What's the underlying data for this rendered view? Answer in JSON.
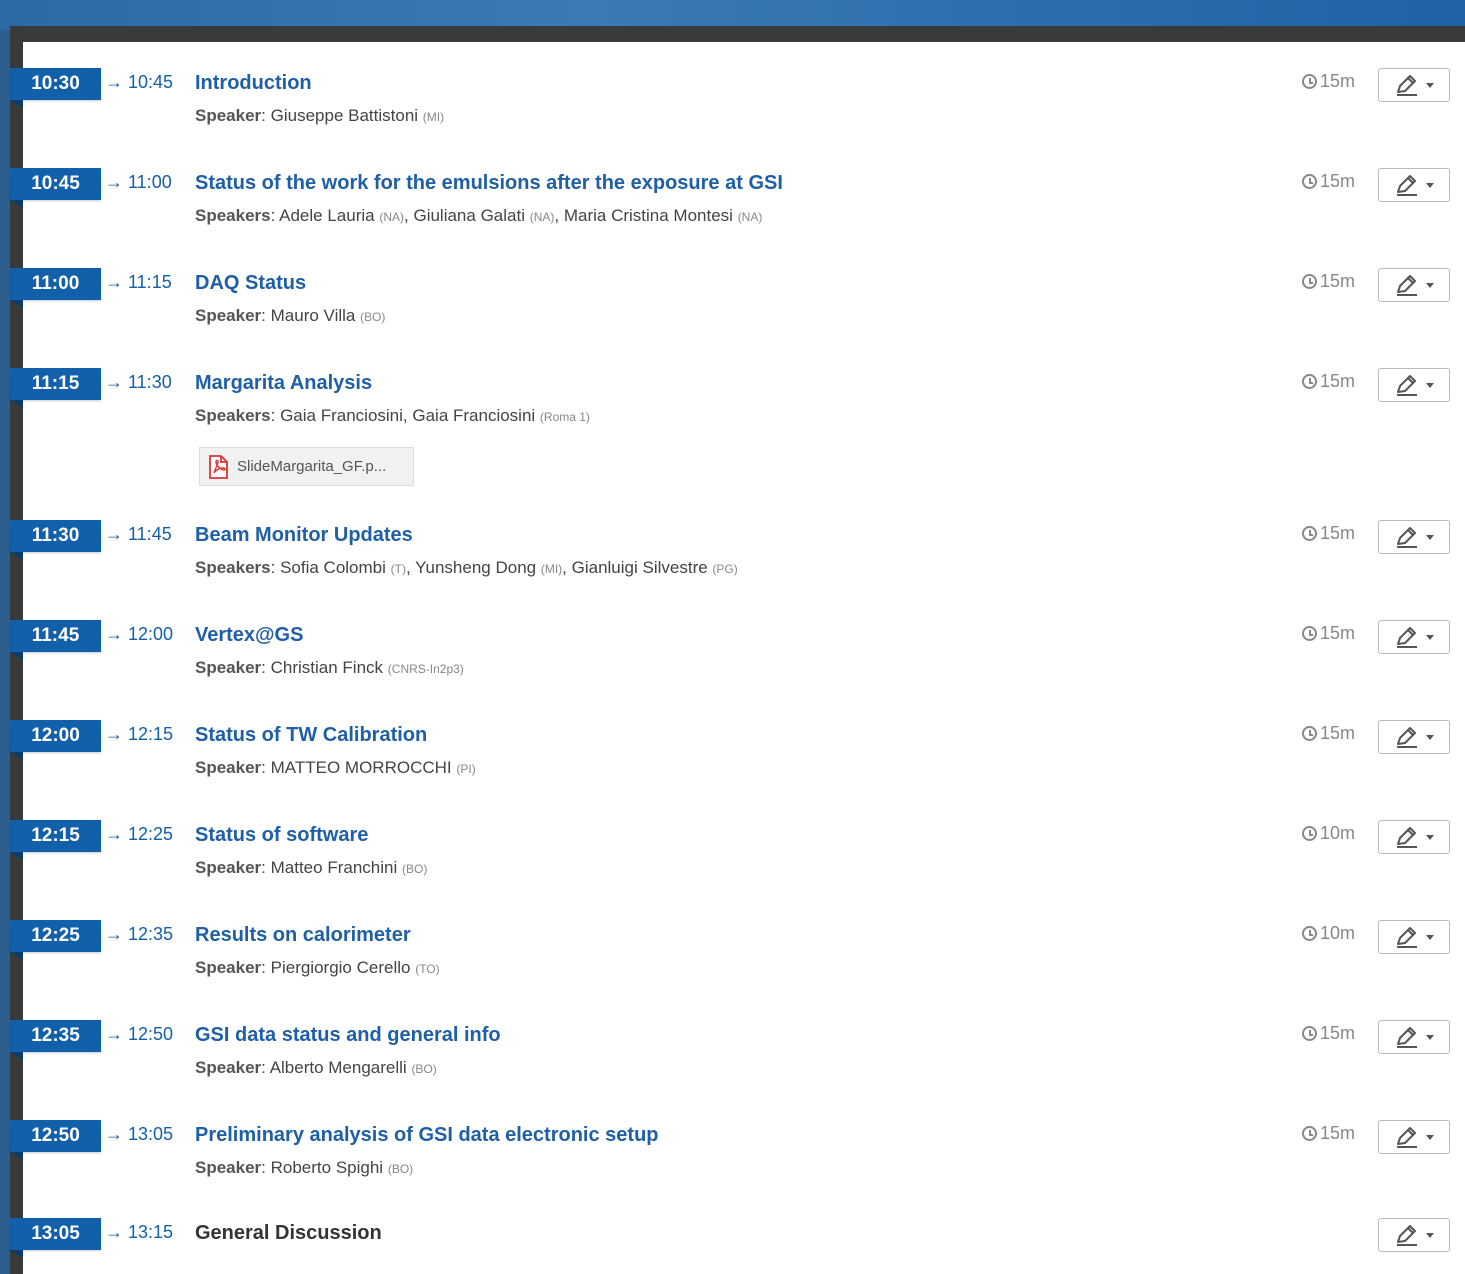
{
  "entries": [
    {
      "start": "10:30",
      "end": "→ 10:45",
      "title": "Introduction",
      "speaker_label": "Speaker",
      "speakers": [
        {
          "name": "Giuseppe Battistoni",
          "aff": "(MI)"
        }
      ],
      "duration": "15m"
    },
    {
      "start": "10:45",
      "end": "→ 11:00",
      "title": "Status of the work for the emulsions after the exposure at GSI",
      "speaker_label": "Speakers",
      "speakers": [
        {
          "name": "Adele Lauria",
          "aff": "(NA)"
        },
        {
          "name": "Giuliana Galati",
          "aff": "(NA)"
        },
        {
          "name": "Maria Cristina Montesi",
          "aff": "(NA)"
        }
      ],
      "duration": "15m"
    },
    {
      "start": "11:00",
      "end": "→ 11:15",
      "title": "DAQ Status",
      "speaker_label": "Speaker",
      "speakers": [
        {
          "name": "Mauro Villa",
          "aff": "(BO)"
        }
      ],
      "duration": "15m"
    },
    {
      "start": "11:15",
      "end": "→ 11:30",
      "title": "Margarita Analysis",
      "speaker_label": "Speakers",
      "speakers": [
        {
          "name": "Gaia Franciosini",
          "aff": ""
        },
        {
          "name": "Gaia Franciosini",
          "aff": "(Roma 1)"
        }
      ],
      "duration": "15m",
      "attachment": "SlideMargarita_GF.p..."
    },
    {
      "start": "11:30",
      "end": "→ 11:45",
      "title": "Beam Monitor Updates",
      "speaker_label": "Speakers",
      "speakers": [
        {
          "name": "Sofia Colombi",
          "aff": "(T)"
        },
        {
          "name": "Yunsheng Dong",
          "aff": "(MI)"
        },
        {
          "name": "Gianluigi Silvestre",
          "aff": "(PG)"
        }
      ],
      "duration": "15m"
    },
    {
      "start": "11:45",
      "end": "→ 12:00",
      "title": "Vertex@GS",
      "speaker_label": "Speaker",
      "speakers": [
        {
          "name": "Christian Finck",
          "aff": "(CNRS-In2p3)"
        }
      ],
      "duration": "15m"
    },
    {
      "start": "12:00",
      "end": "→ 12:15",
      "title": "Status of TW Calibration",
      "speaker_label": "Speaker",
      "speakers": [
        {
          "name": "MATTEO MORROCCHI",
          "aff": "(PI)"
        }
      ],
      "duration": "15m"
    },
    {
      "start": "12:15",
      "end": "→ 12:25",
      "title": "Status of software",
      "speaker_label": "Speaker",
      "speakers": [
        {
          "name": "Matteo Franchini",
          "aff": "(BO)"
        }
      ],
      "duration": "10m"
    },
    {
      "start": "12:25",
      "end": "→ 12:35",
      "title": "Results on calorimeter",
      "speaker_label": "Speaker",
      "speakers": [
        {
          "name": "Piergiorgio Cerello",
          "aff": "(TO)"
        }
      ],
      "duration": "10m"
    },
    {
      "start": "12:35",
      "end": "→ 12:50",
      "title": "GSI data status and general info",
      "speaker_label": "Speaker",
      "speakers": [
        {
          "name": "Alberto Mengarelli",
          "aff": "(BO)"
        }
      ],
      "duration": "15m"
    },
    {
      "start": "12:50",
      "end": "→ 13:05",
      "title": "Preliminary analysis of GSI data electronic setup",
      "speaker_label": "Speaker",
      "speakers": [
        {
          "name": "Roberto Spighi",
          "aff": "(BO)"
        }
      ],
      "duration": "15m"
    },
    {
      "start": "13:05",
      "end": "→ 13:15",
      "title": "General Discussion",
      "speaker_label": "",
      "speakers": [],
      "duration": "",
      "plain": true
    }
  ],
  "icons": {
    "edit": "pencil-edit-icon",
    "clock": "clock-icon",
    "pdf": "pdf-file-icon"
  },
  "colors": {
    "accent": "#125faa",
    "title": "#1f5fa6",
    "muted": "#888888"
  }
}
